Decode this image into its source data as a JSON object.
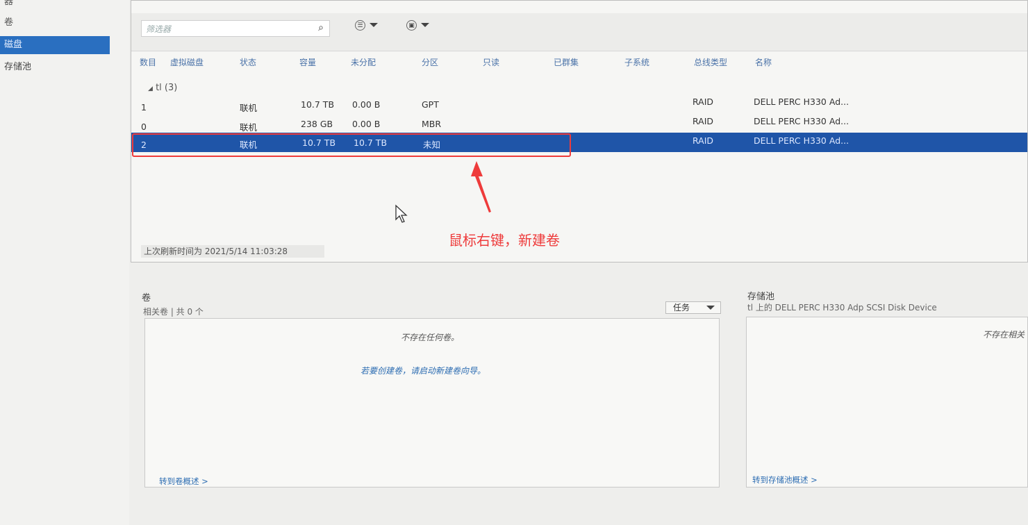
{
  "nav": {
    "items": [
      {
        "label": "器"
      },
      {
        "label": "卷"
      },
      {
        "label": "磁盘"
      },
      {
        "label": "存储池"
      }
    ]
  },
  "disks": {
    "filter_placeholder": "筛选器",
    "columns": [
      "数目",
      "虚拟磁盘",
      "状态",
      "容量",
      "未分配",
      "分区",
      "只读",
      "已群集",
      "子系统",
      "总线类型",
      "名称"
    ],
    "group_label": "tl (3)",
    "rows": [
      {
        "number": "1",
        "status": "联机",
        "capacity": "10.7 TB",
        "unallocated": "0.00 B",
        "partition": "GPT",
        "bus": "RAID",
        "name": "DELL PERC H330 Ad..."
      },
      {
        "number": "0",
        "status": "联机",
        "capacity": "238 GB",
        "unallocated": "0.00 B",
        "partition": "MBR",
        "bus": "RAID",
        "name": "DELL PERC H330 Ad..."
      },
      {
        "number": "2",
        "status": "联机",
        "capacity": "10.7 TB",
        "unallocated": "10.7 TB",
        "partition": "未知",
        "bus": "RAID",
        "name": "DELL PERC H330 Ad..."
      }
    ],
    "last_refresh": "上次刷新时间为 2021/5/14 11:03:28"
  },
  "annotation": {
    "text": "鼠标右键，新建卷",
    "color": "#ee3b3b"
  },
  "volumes": {
    "title": "卷",
    "subtitle": "相关卷 | 共 0 个",
    "task_label": "任务",
    "empty": "不存在任何卷。",
    "wizard": "若要创建卷，请启动新建卷向导。",
    "goto": "转到卷概述 >"
  },
  "pool": {
    "title": "存储池",
    "subtitle": "tl 上的 DELL PERC H330 Adp SCSI Disk Device",
    "empty": "不存在相关",
    "goto": "转到存储池概述 >"
  },
  "colors": {
    "selection": "#1f55a8",
    "nav_selection": "#2a6fc0",
    "header_text": "#4a72a8",
    "link": "#2d6db2"
  }
}
